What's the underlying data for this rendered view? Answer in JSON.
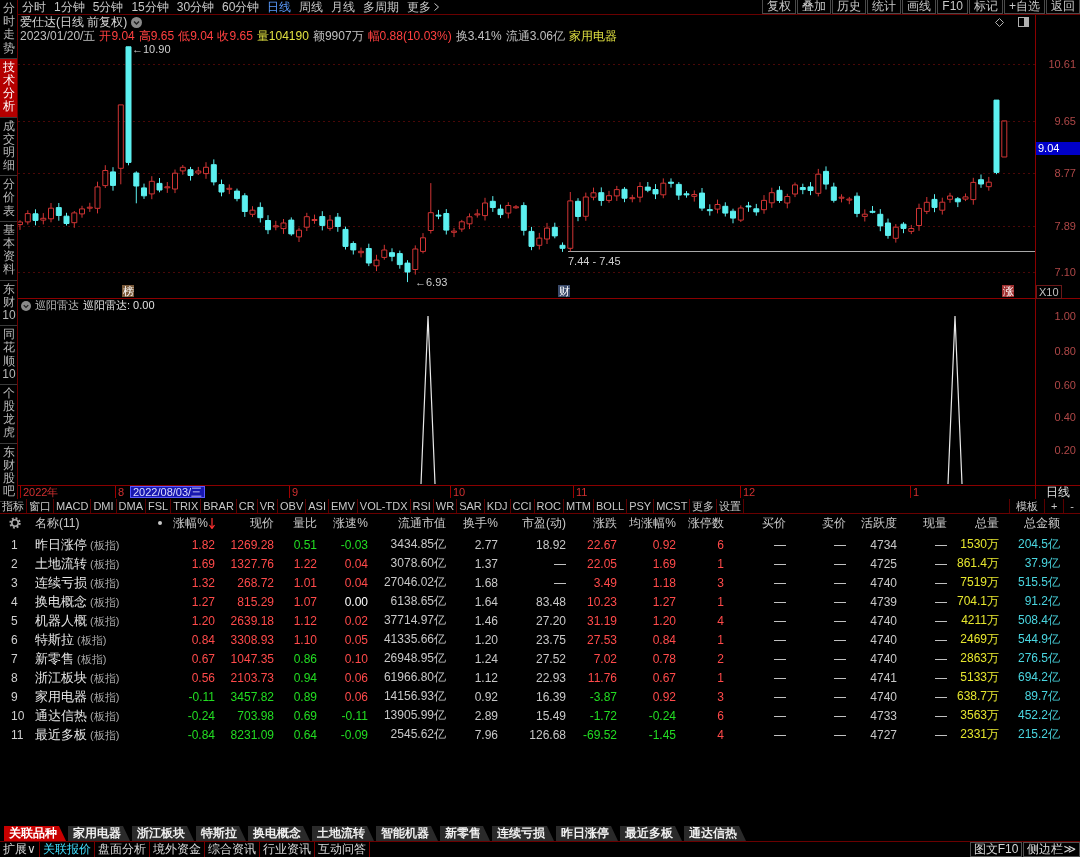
{
  "sidebar": {
    "tabs": [
      {
        "label": "分时走势",
        "selected": false
      },
      {
        "label": "技术分析",
        "selected": true
      },
      {
        "label": "成交明细",
        "selected": false
      },
      {
        "label": "分价表",
        "selected": false
      },
      {
        "label": "基本资料",
        "selected": false
      },
      {
        "label": "东财10",
        "selected": false
      },
      {
        "label": "同花顺10",
        "selected": false
      },
      {
        "label": "个股龙虎",
        "selected": false
      },
      {
        "label": "东财股吧",
        "selected": false
      }
    ]
  },
  "toolbar": {
    "periods": [
      {
        "label": "分时",
        "selected": false
      },
      {
        "label": "1分钟",
        "selected": false
      },
      {
        "label": "5分钟",
        "selected": false
      },
      {
        "label": "15分钟",
        "selected": false
      },
      {
        "label": "30分钟",
        "selected": false
      },
      {
        "label": "60分钟",
        "selected": false
      },
      {
        "label": "日线",
        "selected": true
      },
      {
        "label": "周线",
        "selected": false
      },
      {
        "label": "月线",
        "selected": false
      },
      {
        "label": "多周期",
        "selected": false
      }
    ],
    "more": "更多",
    "actions": [
      "复权",
      "叠加",
      "历史",
      "统计",
      "画线",
      "F10",
      "标记",
      "+自选",
      "返回"
    ]
  },
  "chart": {
    "title": "爱仕达(日线 前复权)",
    "quote": [
      {
        "text": "2023/01/20/五",
        "color": "#c0c0c0"
      },
      {
        "text": "开9.04",
        "color": "#ff4040"
      },
      {
        "text": "高9.65",
        "color": "#ff4040"
      },
      {
        "text": "低9.04",
        "color": "#ff4040"
      },
      {
        "text": "收9.65",
        "color": "#ff4040"
      },
      {
        "text": "量104190",
        "color": "#e0e040"
      },
      {
        "text": "额9907万",
        "color": "#c0c0c0"
      },
      {
        "text": "幅0.88(10.03%)",
        "color": "#ff4040"
      },
      {
        "text": "换3.41%",
        "color": "#c0c0c0"
      },
      {
        "text": "流通3.06亿",
        "color": "#c0c0c0"
      },
      {
        "text": "家用电器",
        "color": "#e0e040"
      }
    ],
    "annotations": {
      "high": "←10.90",
      "low": "←6.93",
      "range": "7.44 - 7.45"
    },
    "markers": [
      {
        "label": "榜",
        "color": "#7a5a3a"
      },
      {
        "label": "财",
        "color": "#3a4a6a"
      },
      {
        "label": "涨",
        "color": "#a03030"
      }
    ],
    "price_axis": {
      "ticks": [
        "10.61",
        "9.65",
        "8.77",
        "7.89",
        "7.10"
      ],
      "current": "9.04",
      "scale": "X10"
    }
  },
  "indicator": {
    "name": "巡阳雷达",
    "reading": "巡阳雷达: 0.00",
    "axis_ticks": [
      "1.00",
      "0.80",
      "0.60",
      "0.40",
      "0.20"
    ]
  },
  "date_axis": {
    "labels": [
      {
        "text": "2022年",
        "selected": false
      },
      {
        "text": "8",
        "selected": false
      },
      {
        "text": "2022/08/03/三",
        "selected": true
      },
      {
        "text": "9",
        "selected": false
      },
      {
        "text": "10",
        "selected": false
      },
      {
        "text": "11",
        "selected": false
      },
      {
        "text": "12",
        "selected": false
      },
      {
        "text": "1",
        "selected": false
      }
    ],
    "period": "日线"
  },
  "indicator_tabs": {
    "items": [
      "指标",
      "窗口",
      "MACD",
      "DMI",
      "DMA",
      "FSL",
      "TRIX",
      "BRAR",
      "CR",
      "VR",
      "OBV",
      "ASI",
      "EMV",
      "VOL-TDX",
      "RSI",
      "WR",
      "SAR",
      "KDJ",
      "CCI",
      "ROC",
      "MTM",
      "BOLL",
      "PSY",
      "MCST",
      "更多",
      "设置"
    ],
    "tools": [
      "模板",
      "+",
      "-"
    ]
  },
  "table": {
    "columns": [
      {
        "label": "名称(11)",
        "sorted": false
      },
      {
        "label": "涨幅%",
        "sorted": true
      },
      {
        "label": "现价",
        "sorted": false
      },
      {
        "label": "量比",
        "sorted": false
      },
      {
        "label": "涨速%",
        "sorted": false
      },
      {
        "label": "流通市值",
        "sorted": false
      },
      {
        "label": "换手%",
        "sorted": false
      },
      {
        "label": "市盈(动)",
        "sorted": false
      },
      {
        "label": "涨跌",
        "sorted": false
      },
      {
        "label": "均涨幅%",
        "sorted": false
      },
      {
        "label": "涨停数",
        "sorted": false
      },
      {
        "label": "买价",
        "sorted": false
      },
      {
        "label": "卖价",
        "sorted": false
      },
      {
        "label": "活跃度",
        "sorted": false
      },
      {
        "label": "现量",
        "sorted": false
      },
      {
        "label": "总量",
        "sorted": false
      },
      {
        "label": "总金额",
        "sorted": false
      }
    ],
    "rows": [
      {
        "no": "1",
        "cells": [
          {
            "text": "昨日涨停",
            "tag": "(板指)"
          },
          {
            "text": "1.82",
            "color": "#ff4a4a"
          },
          {
            "text": "1269.28",
            "color": "#ff4a4a"
          },
          {
            "text": "0.51",
            "color": "#22dd22"
          },
          {
            "text": "-0.03",
            "color": "#22dd22"
          },
          {
            "text": "3434.85亿",
            "color": "#c8c8c8"
          },
          {
            "text": "2.77",
            "color": "#c8c8c8"
          },
          {
            "text": "18.92",
            "color": "#c8c8c8"
          },
          {
            "text": "22.67",
            "color": "#ff4a4a"
          },
          {
            "text": "0.92",
            "color": "#ff4a4a"
          },
          {
            "text": "6",
            "color": "#ff4a4a"
          },
          {
            "text": "—"
          },
          {
            "text": "—"
          },
          {
            "text": "4734",
            "color": "#c8c8c8"
          },
          {
            "text": "—"
          },
          {
            "text": "1530万",
            "color": "#e6e62e"
          },
          {
            "text": "204.5亿",
            "color": "#4ad6e0"
          }
        ]
      },
      {
        "no": "2",
        "cells": [
          {
            "text": "土地流转",
            "tag": "(板指)"
          },
          {
            "text": "1.69",
            "color": "#ff4a4a"
          },
          {
            "text": "1327.76",
            "color": "#ff4a4a"
          },
          {
            "text": "1.22",
            "color": "#ff4a4a"
          },
          {
            "text": "0.04",
            "color": "#ff4a4a"
          },
          {
            "text": "3078.60亿",
            "color": "#c8c8c8"
          },
          {
            "text": "1.37",
            "color": "#c8c8c8"
          },
          {
            "text": "—"
          },
          {
            "text": "22.05",
            "color": "#ff4a4a"
          },
          {
            "text": "1.69",
            "color": "#ff4a4a"
          },
          {
            "text": "1",
            "color": "#ff4a4a"
          },
          {
            "text": "—"
          },
          {
            "text": "—"
          },
          {
            "text": "4725",
            "color": "#c8c8c8"
          },
          {
            "text": "—"
          },
          {
            "text": "861.4万",
            "color": "#e6e62e"
          },
          {
            "text": "37.9亿",
            "color": "#4ad6e0"
          }
        ]
      },
      {
        "no": "3",
        "cells": [
          {
            "text": "连续亏损",
            "tag": "(板指)"
          },
          {
            "text": "1.32",
            "color": "#ff4a4a"
          },
          {
            "text": "268.72",
            "color": "#ff4a4a"
          },
          {
            "text": "1.01",
            "color": "#ff4a4a"
          },
          {
            "text": "0.04",
            "color": "#ff4a4a"
          },
          {
            "text": "27046.02亿",
            "color": "#c8c8c8"
          },
          {
            "text": "1.68",
            "color": "#c8c8c8"
          },
          {
            "text": "—"
          },
          {
            "text": "3.49",
            "color": "#ff4a4a"
          },
          {
            "text": "1.18",
            "color": "#ff4a4a"
          },
          {
            "text": "3",
            "color": "#ff4a4a"
          },
          {
            "text": "—"
          },
          {
            "text": "—"
          },
          {
            "text": "4740",
            "color": "#c8c8c8"
          },
          {
            "text": "—"
          },
          {
            "text": "7519万",
            "color": "#e6e62e"
          },
          {
            "text": "515.5亿",
            "color": "#4ad6e0"
          }
        ]
      },
      {
        "no": "4",
        "cells": [
          {
            "text": "换电概念",
            "tag": "(板指)"
          },
          {
            "text": "1.27",
            "color": "#ff4a4a"
          },
          {
            "text": "815.29",
            "color": "#ff4a4a"
          },
          {
            "text": "1.07",
            "color": "#ff4a4a"
          },
          {
            "text": "0.00",
            "color": "#ffffff"
          },
          {
            "text": "6138.65亿",
            "color": "#c8c8c8"
          },
          {
            "text": "1.64",
            "color": "#c8c8c8"
          },
          {
            "text": "83.48",
            "color": "#c8c8c8"
          },
          {
            "text": "10.23",
            "color": "#ff4a4a"
          },
          {
            "text": "1.27",
            "color": "#ff4a4a"
          },
          {
            "text": "1",
            "color": "#ff4a4a"
          },
          {
            "text": "—"
          },
          {
            "text": "—"
          },
          {
            "text": "4739",
            "color": "#c8c8c8"
          },
          {
            "text": "—"
          },
          {
            "text": "704.1万",
            "color": "#e6e62e"
          },
          {
            "text": "91.2亿",
            "color": "#4ad6e0"
          }
        ]
      },
      {
        "no": "5",
        "cells": [
          {
            "text": "机器人概",
            "tag": "(板指)"
          },
          {
            "text": "1.20",
            "color": "#ff4a4a"
          },
          {
            "text": "2639.18",
            "color": "#ff4a4a"
          },
          {
            "text": "1.12",
            "color": "#ff4a4a"
          },
          {
            "text": "0.02",
            "color": "#ff4a4a"
          },
          {
            "text": "37714.97亿",
            "color": "#c8c8c8"
          },
          {
            "text": "1.46",
            "color": "#c8c8c8"
          },
          {
            "text": "27.20",
            "color": "#c8c8c8"
          },
          {
            "text": "31.19",
            "color": "#ff4a4a"
          },
          {
            "text": "1.20",
            "color": "#ff4a4a"
          },
          {
            "text": "4",
            "color": "#ff4a4a"
          },
          {
            "text": "—"
          },
          {
            "text": "—"
          },
          {
            "text": "4740",
            "color": "#c8c8c8"
          },
          {
            "text": "—"
          },
          {
            "text": "4211万",
            "color": "#e6e62e"
          },
          {
            "text": "508.4亿",
            "color": "#4ad6e0"
          }
        ]
      },
      {
        "no": "6",
        "cells": [
          {
            "text": "特斯拉",
            "tag": "(板指)"
          },
          {
            "text": "0.84",
            "color": "#ff4a4a"
          },
          {
            "text": "3308.93",
            "color": "#ff4a4a"
          },
          {
            "text": "1.10",
            "color": "#ff4a4a"
          },
          {
            "text": "0.05",
            "color": "#ff4a4a"
          },
          {
            "text": "41335.66亿",
            "color": "#c8c8c8"
          },
          {
            "text": "1.20",
            "color": "#c8c8c8"
          },
          {
            "text": "23.75",
            "color": "#c8c8c8"
          },
          {
            "text": "27.53",
            "color": "#ff4a4a"
          },
          {
            "text": "0.84",
            "color": "#ff4a4a"
          },
          {
            "text": "1",
            "color": "#ff4a4a"
          },
          {
            "text": "—"
          },
          {
            "text": "—"
          },
          {
            "text": "4740",
            "color": "#c8c8c8"
          },
          {
            "text": "—"
          },
          {
            "text": "2469万",
            "color": "#e6e62e"
          },
          {
            "text": "544.9亿",
            "color": "#4ad6e0"
          }
        ]
      },
      {
        "no": "7",
        "cells": [
          {
            "text": "新零售",
            "tag": "(板指)"
          },
          {
            "text": "0.67",
            "color": "#ff4a4a"
          },
          {
            "text": "1047.35",
            "color": "#ff4a4a"
          },
          {
            "text": "0.86",
            "color": "#22dd22"
          },
          {
            "text": "0.10",
            "color": "#ff4a4a"
          },
          {
            "text": "26948.95亿",
            "color": "#c8c8c8"
          },
          {
            "text": "1.24",
            "color": "#c8c8c8"
          },
          {
            "text": "27.52",
            "color": "#c8c8c8"
          },
          {
            "text": "7.02",
            "color": "#ff4a4a"
          },
          {
            "text": "0.78",
            "color": "#ff4a4a"
          },
          {
            "text": "2",
            "color": "#ff4a4a"
          },
          {
            "text": "—"
          },
          {
            "text": "—"
          },
          {
            "text": "4740",
            "color": "#c8c8c8"
          },
          {
            "text": "—"
          },
          {
            "text": "2863万",
            "color": "#e6e62e"
          },
          {
            "text": "276.5亿",
            "color": "#4ad6e0"
          }
        ]
      },
      {
        "no": "8",
        "cells": [
          {
            "text": "浙江板块",
            "tag": "(板指)"
          },
          {
            "text": "0.56",
            "color": "#ff4a4a"
          },
          {
            "text": "2103.73",
            "color": "#ff4a4a"
          },
          {
            "text": "0.94",
            "color": "#22dd22"
          },
          {
            "text": "0.06",
            "color": "#ff4a4a"
          },
          {
            "text": "61966.80亿",
            "color": "#c8c8c8"
          },
          {
            "text": "1.12",
            "color": "#c8c8c8"
          },
          {
            "text": "22.93",
            "color": "#c8c8c8"
          },
          {
            "text": "11.76",
            "color": "#ff4a4a"
          },
          {
            "text": "0.67",
            "color": "#ff4a4a"
          },
          {
            "text": "1",
            "color": "#ff4a4a"
          },
          {
            "text": "—"
          },
          {
            "text": "—"
          },
          {
            "text": "4741",
            "color": "#c8c8c8"
          },
          {
            "text": "—"
          },
          {
            "text": "5133万",
            "color": "#e6e62e"
          },
          {
            "text": "694.2亿",
            "color": "#4ad6e0"
          }
        ]
      },
      {
        "no": "9",
        "cells": [
          {
            "text": "家用电器",
            "tag": "(板指)"
          },
          {
            "text": "-0.11",
            "color": "#22dd22"
          },
          {
            "text": "3457.82",
            "color": "#22dd22"
          },
          {
            "text": "0.89",
            "color": "#22dd22"
          },
          {
            "text": "0.06",
            "color": "#ff4a4a"
          },
          {
            "text": "14156.93亿",
            "color": "#c8c8c8"
          },
          {
            "text": "0.92",
            "color": "#c8c8c8"
          },
          {
            "text": "16.39",
            "color": "#c8c8c8"
          },
          {
            "text": "-3.87",
            "color": "#22dd22"
          },
          {
            "text": "0.92",
            "color": "#ff4a4a"
          },
          {
            "text": "3",
            "color": "#ff4a4a"
          },
          {
            "text": "—"
          },
          {
            "text": "—"
          },
          {
            "text": "4740",
            "color": "#c8c8c8"
          },
          {
            "text": "—"
          },
          {
            "text": "638.7万",
            "color": "#e6e62e"
          },
          {
            "text": "89.7亿",
            "color": "#4ad6e0"
          }
        ]
      },
      {
        "no": "10",
        "cells": [
          {
            "text": "通达信热",
            "tag": "(板指)"
          },
          {
            "text": "-0.24",
            "color": "#22dd22"
          },
          {
            "text": "703.98",
            "color": "#22dd22"
          },
          {
            "text": "0.69",
            "color": "#22dd22"
          },
          {
            "text": "-0.11",
            "color": "#22dd22"
          },
          {
            "text": "13905.99亿",
            "color": "#c8c8c8"
          },
          {
            "text": "2.89",
            "color": "#c8c8c8"
          },
          {
            "text": "15.49",
            "color": "#c8c8c8"
          },
          {
            "text": "-1.72",
            "color": "#22dd22"
          },
          {
            "text": "-0.24",
            "color": "#22dd22"
          },
          {
            "text": "6",
            "color": "#ff4a4a"
          },
          {
            "text": "—"
          },
          {
            "text": "—"
          },
          {
            "text": "4733",
            "color": "#c8c8c8"
          },
          {
            "text": "—"
          },
          {
            "text": "3563万",
            "color": "#e6e62e"
          },
          {
            "text": "452.2亿",
            "color": "#4ad6e0"
          }
        ]
      },
      {
        "no": "11",
        "cells": [
          {
            "text": "最近多板",
            "tag": "(板指)"
          },
          {
            "text": "-0.84",
            "color": "#22dd22"
          },
          {
            "text": "8231.09",
            "color": "#22dd22"
          },
          {
            "text": "0.64",
            "color": "#22dd22"
          },
          {
            "text": "-0.09",
            "color": "#22dd22"
          },
          {
            "text": "2545.62亿",
            "color": "#c8c8c8"
          },
          {
            "text": "7.96",
            "color": "#c8c8c8"
          },
          {
            "text": "126.68",
            "color": "#c8c8c8"
          },
          {
            "text": "-69.52",
            "color": "#22dd22"
          },
          {
            "text": "-1.45",
            "color": "#22dd22"
          },
          {
            "text": "4",
            "color": "#ff4a4a"
          },
          {
            "text": "—"
          },
          {
            "text": "—"
          },
          {
            "text": "4727",
            "color": "#c8c8c8"
          },
          {
            "text": "—"
          },
          {
            "text": "2331万",
            "color": "#e6e62e"
          },
          {
            "text": "215.2亿",
            "color": "#4ad6e0"
          }
        ]
      }
    ]
  },
  "related_tabs": [
    {
      "label": "关联品种",
      "selected": true
    },
    {
      "label": "家用电器",
      "selected": false
    },
    {
      "label": "浙江板块",
      "selected": false
    },
    {
      "label": "特斯拉",
      "selected": false
    },
    {
      "label": "换电概念",
      "selected": false
    },
    {
      "label": "土地流转",
      "selected": false
    },
    {
      "label": "智能机器",
      "selected": false
    },
    {
      "label": "新零售",
      "selected": false
    },
    {
      "label": "连续亏损",
      "selected": false
    },
    {
      "label": "昨日涨停",
      "selected": false
    },
    {
      "label": "最近多板",
      "selected": false
    },
    {
      "label": "通达信热",
      "selected": false
    }
  ],
  "status_bar": {
    "items": [
      {
        "label": "扩展∨",
        "selected": false
      },
      {
        "label": "关联报价",
        "selected": true
      },
      {
        "label": "盘面分析",
        "selected": false
      },
      {
        "label": "境外资金",
        "selected": false
      },
      {
        "label": "综合资讯",
        "selected": false
      },
      {
        "label": "行业资讯",
        "selected": false
      },
      {
        "label": "互动问答",
        "selected": false
      }
    ],
    "right": [
      "图文F10",
      "侧边栏≫"
    ]
  }
}
